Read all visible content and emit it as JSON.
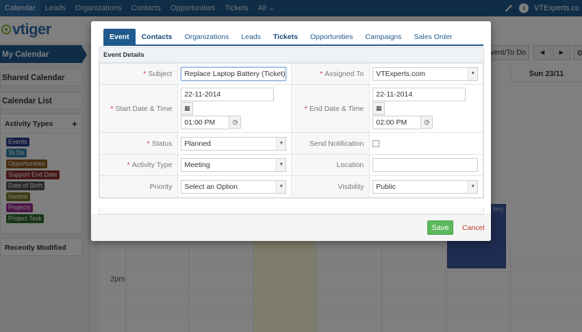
{
  "topnav": {
    "items": [
      "Calendar",
      "Leads",
      "Organizations",
      "Contacts",
      "Opportunities",
      "Tickets",
      "All"
    ],
    "all_caret": "⌄",
    "user": "VTExperts.co"
  },
  "logo": {
    "mark": "⊙",
    "text": "vtiger"
  },
  "sidebar": {
    "my_calendar": "My Calendar",
    "shared_calendar": "Shared Calendar",
    "calendar_list": "Calendar List",
    "activity_types": "Activity Types",
    "activity_plus": "+",
    "tags": [
      {
        "label": "Events",
        "color": "#2b3f8f"
      },
      {
        "label": "To Do",
        "color": "#3a86a8"
      },
      {
        "label": "Opportunities",
        "color": "#8a5a1e"
      },
      {
        "label": "Support End Date",
        "color": "#8c2d2d"
      },
      {
        "label": "Date of Birth",
        "color": "#555555"
      },
      {
        "label": "Invoice",
        "color": "#7a7a2a"
      },
      {
        "label": "Projects",
        "color": "#9b2b8f"
      },
      {
        "label": "Project Task",
        "color": "#2d6b2d"
      }
    ],
    "recently_modified": "Recently Modified"
  },
  "calendar": {
    "event_todo_btn": "vent/To Do",
    "prev": "◄",
    "next": "►",
    "settings": "⚙",
    "sun_header": "Sun 23/11",
    "time_label": "2pm",
    "event_block_text": "ttery"
  },
  "modal": {
    "tabs": [
      {
        "label": "Event",
        "active": true,
        "bold": true
      },
      {
        "label": "Contacts",
        "active": false,
        "bold": true
      },
      {
        "label": "Organizations",
        "active": false,
        "bold": false
      },
      {
        "label": "Leads",
        "active": false,
        "bold": false
      },
      {
        "label": "Tickets",
        "active": false,
        "bold": true
      },
      {
        "label": "Opportunities",
        "active": false,
        "bold": false
      },
      {
        "label": "Campaigns",
        "active": false,
        "bold": false
      },
      {
        "label": "Sales Order",
        "active": false,
        "bold": false
      }
    ],
    "section_title": "Event Details",
    "req_mark": "*",
    "subject_label": "Subject",
    "subject_value": "Replace Laptop Battery (Ticket)",
    "assigned_to_label": "Assigned To",
    "assigned_to_value": "VTExperts.com",
    "start_label": "Start Date & Time",
    "start_date": "22-11-2014",
    "start_time": "01:00 PM",
    "end_label": "End Date & Time",
    "end_date": "22-11-2014",
    "end_time": "02:00 PM",
    "calendar_glyph": "▦",
    "clock_glyph": "◷",
    "status_label": "Status",
    "status_value": "Planned",
    "send_notification_label": "Send Notification",
    "activity_type_label": "Activity Type",
    "activity_type_value": "Meeting",
    "location_label": "Location",
    "location_value": "",
    "priority_label": "Priority",
    "priority_value": "Select an Option",
    "visibility_label": "Visibility",
    "visibility_value": "Public",
    "dropdown_arrow": "▼",
    "save_label": "Save",
    "cancel_label": "Cancel"
  }
}
